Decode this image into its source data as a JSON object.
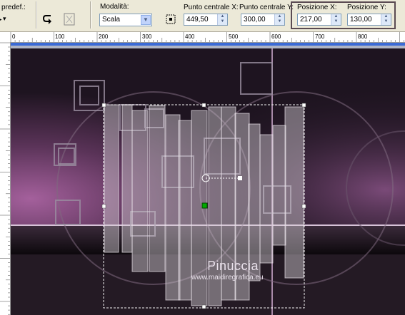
{
  "toolbar": {
    "preset_label": "predef.:",
    "mode_label": "Modalità:",
    "mode_value": "Scala",
    "center_x_label": "Punto centrale X:",
    "center_x_value": "449,50",
    "center_y_label": "Punto centrale Y:",
    "center_y_value": "300,00",
    "pos_x_label": "Posizione X:",
    "pos_x_value": "217,00",
    "pos_y_label": "Posizione Y:",
    "pos_y_value": "130,00"
  },
  "ruler": {
    "ticks": [
      "0",
      "100",
      "200",
      "300",
      "400",
      "500",
      "600",
      "700",
      "800"
    ]
  },
  "watermark": {
    "name": "Pinuccia",
    "url": "www.maidiregrafica.eu"
  },
  "colors": {
    "accent_purple": "#7a4a80",
    "highlight_box": "#5a4a52",
    "selection_handle": "#00aa00"
  }
}
